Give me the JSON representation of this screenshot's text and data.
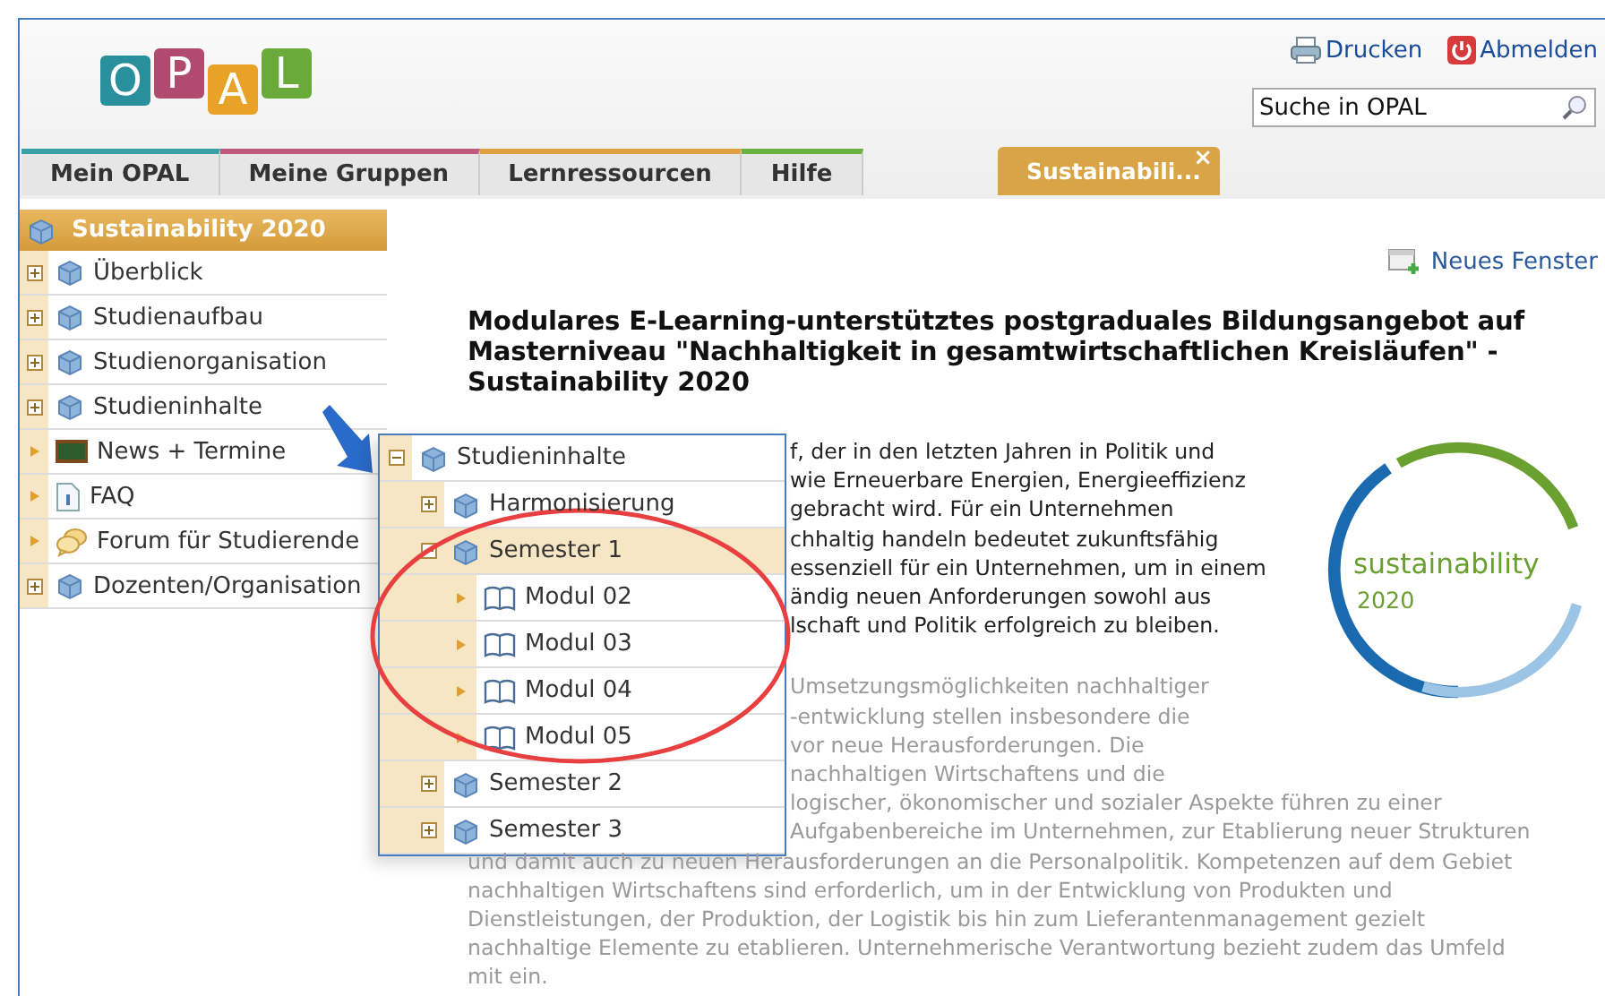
{
  "header": {
    "logo_letters": [
      {
        "letter": "O",
        "color": "#2a8f9c"
      },
      {
        "letter": "P",
        "color": "#b04a6e"
      },
      {
        "letter": "A",
        "color": "#e8a228"
      },
      {
        "letter": "L",
        "color": "#6aaa3a"
      }
    ],
    "links": [
      {
        "label": "Drucken",
        "kind": "print"
      },
      {
        "label": "Abmelden",
        "kind": "logout"
      }
    ],
    "search": {
      "placeholder": "Suche in OPAL"
    },
    "tabs": [
      {
        "label": "Mein OPAL",
        "color": "#3aa0a8"
      },
      {
        "label": "Meine Gruppen",
        "color": "#c05a7a"
      },
      {
        "label": "Lernressourcen",
        "color": "#e0a040"
      },
      {
        "label": "Hilfe",
        "color": "#6ab040"
      }
    ],
    "open_tabs": [
      {
        "label": "Sustainabili...",
        "close": "×",
        "selected": true
      }
    ]
  },
  "sidebar": {
    "title": "Sustainability 2020",
    "items": [
      {
        "label": "Überblick",
        "kind": "course",
        "expandable": true,
        "expanded": false
      },
      {
        "label": "Studienaufbau",
        "kind": "course",
        "expandable": true,
        "expanded": false
      },
      {
        "label": "Studienorganisation",
        "kind": "course",
        "expandable": true,
        "expanded": false
      },
      {
        "label": "Studieninhalte",
        "kind": "course",
        "expandable": true,
        "expanded": false
      },
      {
        "label": "News + Termine",
        "kind": "news",
        "expandable": false,
        "expanded": false
      },
      {
        "label": "FAQ",
        "kind": "faq",
        "expandable": false,
        "expanded": false
      },
      {
        "label": "Forum für Studierende",
        "kind": "forum",
        "expandable": false,
        "expanded": false
      },
      {
        "label": "Dozenten/Organisation",
        "kind": "course",
        "expandable": true,
        "expanded": false
      }
    ]
  },
  "popup_tree": {
    "label": "Studieninhalte",
    "kind": "course",
    "expandable": true,
    "expanded": true,
    "selected": false,
    "children": [
      {
        "label": "Harmonisierung",
        "kind": "course",
        "expandable": true,
        "expanded": false,
        "selected": false
      },
      {
        "label": "Semester 1",
        "kind": "course",
        "expandable": true,
        "expanded": true,
        "selected": true,
        "children": [
          {
            "label": "Modul 02",
            "kind": "module",
            "expandable": false,
            "expanded": false,
            "selected": false
          },
          {
            "label": "Modul 03",
            "kind": "module",
            "expandable": false,
            "expanded": false,
            "selected": false
          },
          {
            "label": "Modul 04",
            "kind": "module",
            "expandable": false,
            "expanded": false,
            "selected": false
          },
          {
            "label": "Modul 05",
            "kind": "module",
            "expandable": false,
            "expanded": false,
            "selected": false
          }
        ]
      },
      {
        "label": "Semester 2",
        "kind": "course",
        "expandable": true,
        "expanded": false,
        "selected": false
      },
      {
        "label": "Semester 3",
        "kind": "course",
        "expandable": true,
        "expanded": false,
        "selected": false
      }
    ]
  },
  "content": {
    "new_window": "Neues Fenster",
    "heading": "Modulares E-Learning-unterstütztes postgraduales Bildungsangebot auf Masterniveau \"Nachhaltigkeit in gesamtwirtschaftlichen Kreisläufen\" - Sustainability 2020",
    "logo": {
      "word": "sustainability",
      "year": "2020"
    },
    "paragraphs": [
      {
        "dimmed": false,
        "lines": [
          {
            "kind": "partial",
            "text": "f, der in den letzten Jahren in Politik und"
          },
          {
            "kind": "partial",
            "text": "wie Erneuerbare Energien, Energieeffizienz"
          },
          {
            "kind": "partial",
            "text": "gebracht wird. Für ein Unternehmen"
          },
          {
            "kind": "partial",
            "text": "chhaltig handeln bedeutet zukunftsfähig"
          },
          {
            "kind": "partial",
            "text": "essenziell für ein Unternehmen, um in einem"
          },
          {
            "kind": "partial",
            "text": "ändig neuen Anforderungen sowohl aus"
          },
          {
            "kind": "partial",
            "text": "lschaft und Politik erfolgreich zu bleiben."
          }
        ]
      },
      {
        "dimmed": true,
        "lines": [
          {
            "kind": "partial",
            "text": "Umsetzungsmöglichkeiten nachhaltiger"
          },
          {
            "kind": "partial",
            "text": "-entwicklung stellen insbesondere die"
          },
          {
            "kind": "partial",
            "text": "vor neue Herausforderungen. Die"
          },
          {
            "kind": "partial",
            "text": "nachhaltigen Wirtschaftens und die"
          },
          {
            "kind": "partial",
            "text": "logischer, ökonomischer und sozialer Aspekte führen zu einer"
          },
          {
            "kind": "partial",
            "text": "Aufgabenbereiche im Unternehmen, zur Etablierung neuer Strukturen"
          },
          {
            "kind": "full",
            "text": "und damit auch zu neuen Herausforderungen an die Personalpolitik. Kompetenzen auf dem Gebiet"
          },
          {
            "kind": "full",
            "text": "nachhaltigen Wirtschaftens sind erforderlich, um in der Entwicklung von Produkten und"
          },
          {
            "kind": "full",
            "text": "Dienstleistungen, der Produktion, der Logistik bis hin zum Lieferantenmanagement gezielt"
          },
          {
            "kind": "full",
            "text": "nachhaltige Elemente zu etablieren. Unternehmerische Verantwortung bezieht zudem das Umfeld"
          },
          {
            "kind": "full",
            "text": "mit ein."
          }
        ]
      }
    ]
  }
}
